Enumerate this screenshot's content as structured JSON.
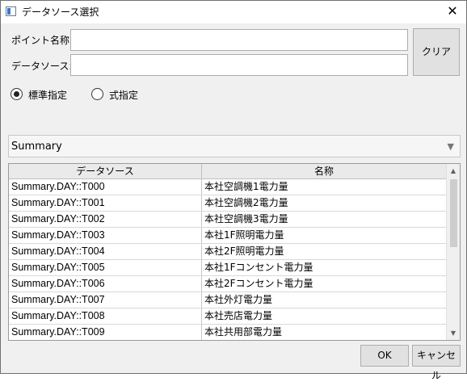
{
  "window": {
    "title": "データソース選択",
    "close_glyph": "✕"
  },
  "form": {
    "point_name_label": "ポイント名称:",
    "point_name_value": "",
    "data_source_label": "データソース:",
    "data_source_value": "",
    "clear_button": "クリア"
  },
  "mode": {
    "standard_label": "標準指定",
    "standard_selected": true,
    "formula_label": "式指定",
    "formula_selected": false
  },
  "category": {
    "selected": "Summary",
    "arrow_glyph": "▼"
  },
  "table": {
    "columns": [
      "データソース",
      "名称"
    ],
    "rows": [
      [
        "Summary.DAY::T000",
        "本社空調機1電力量"
      ],
      [
        "Summary.DAY::T001",
        "本社空調機2電力量"
      ],
      [
        "Summary.DAY::T002",
        "本社空調機3電力量"
      ],
      [
        "Summary.DAY::T003",
        "本社1F照明電力量"
      ],
      [
        "Summary.DAY::T004",
        "本社2F照明電力量"
      ],
      [
        "Summary.DAY::T005",
        "本社1Fコンセント電力量"
      ],
      [
        "Summary.DAY::T006",
        "本社2Fコンセント電力量"
      ],
      [
        "Summary.DAY::T007",
        "本社外灯電力量"
      ],
      [
        "Summary.DAY::T008",
        "本社売店電力量"
      ],
      [
        "Summary.DAY::T009",
        "本社共用部電力量"
      ]
    ],
    "scroll_up_glyph": "▲",
    "scroll_down_glyph": "▼"
  },
  "footer": {
    "ok_button": "OK",
    "cancel_button": "キャンセル"
  }
}
